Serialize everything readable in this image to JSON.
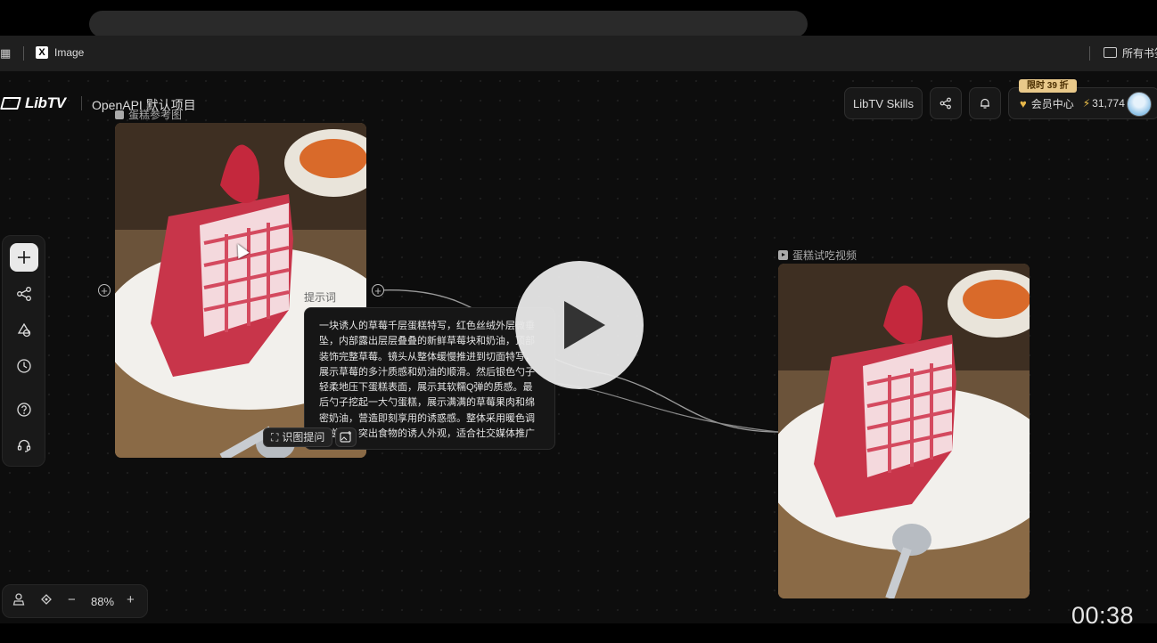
{
  "bookmarks": {
    "image_link": "Image",
    "folder_label": "所有书签"
  },
  "header": {
    "brand": "LibTV",
    "project_name": "OpenAPI 默认项目",
    "skills_button": "LibTV Skills",
    "promo_badge": "限时 39 折",
    "member_center": "会员中心",
    "credits": "31,774"
  },
  "nodes": {
    "reference_image_label": "蛋糕参考图",
    "prompt_label": "提示词",
    "prompt_text": "一块诱人的草莓千层蛋糕特写，红色丝绒外层微垂坠，内部露出层层叠叠的新鲜草莓块和奶油，顶部装饰完整草莓。镜头从整体缓慢推进到切面特写，展示草莓的多汁质感和奶油的顺滑。然后银色勺子轻柔地压下蛋糕表面，展示其软糯Q弹的质感。最后勺子挖起一大勺蛋糕，展示满满的草莓果肉和绵密奶油，营造即刻享用的诱惑感。整体采用暖色调侧逆光，突出食物的诱人外观，适合社交媒体推广",
    "recognize_button": "识图提问",
    "video_label": "蛋糕试吃视频"
  },
  "zoom": {
    "value": "88%"
  },
  "player": {
    "time": "00:38"
  },
  "colors": {
    "canvas_bg": "#0d0d0d",
    "cake_red": "#c8354a",
    "promo_gold": "#e9c98a"
  }
}
